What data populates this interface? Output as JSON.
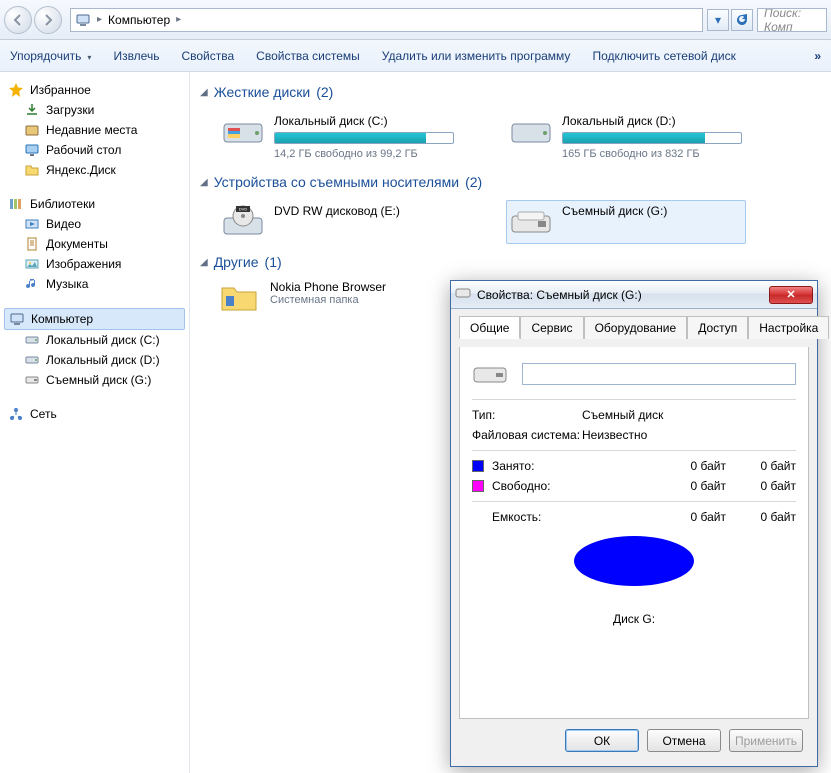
{
  "nav": {
    "breadcrumb": "Компьютер",
    "search_placeholder": "Поиск: Комп"
  },
  "toolbar": {
    "organize": "Упорядочить",
    "eject": "Извлечь",
    "properties": "Свойства",
    "system_properties": "Свойства системы",
    "add_remove_programs": "Удалить или изменить программу",
    "map_network_drive": "Подключить сетевой диск",
    "more": "»"
  },
  "sidebar": {
    "favorites": {
      "label": "Избранное",
      "items": [
        {
          "label": "Загрузки",
          "icon": "download-icon",
          "color": "#2e7d32"
        },
        {
          "label": "Недавние места",
          "icon": "recent-icon",
          "color": "#8d6e3c"
        },
        {
          "label": "Рабочий стол",
          "icon": "desktop-icon",
          "color": "#2a6fb8"
        },
        {
          "label": "Яндекс.Диск",
          "icon": "yandex-icon",
          "color": "#f0c000"
        }
      ]
    },
    "libraries": {
      "label": "Библиотеки",
      "items": [
        {
          "label": "Видео",
          "icon": "video-icon",
          "color": "#3f7fbf"
        },
        {
          "label": "Документы",
          "icon": "documents-icon",
          "color": "#d59b3b"
        },
        {
          "label": "Изображения",
          "icon": "images-icon",
          "color": "#5aa5b8"
        },
        {
          "label": "Музыка",
          "icon": "music-icon",
          "color": "#4a7fca"
        }
      ]
    },
    "computer": {
      "label": "Компьютер",
      "items": [
        {
          "label": "Локальный диск (C:)",
          "icon": "hdd-icon"
        },
        {
          "label": "Локальный диск (D:)",
          "icon": "hdd-icon"
        },
        {
          "label": "Съемный диск (G:)",
          "icon": "removable-icon"
        }
      ]
    },
    "network": {
      "label": "Сеть"
    }
  },
  "content": {
    "sections": [
      {
        "title": "Жесткие диски",
        "count": "(2)",
        "drives": [
          {
            "name": "Локальный диск (C:)",
            "sub": "14,2 ГБ свободно из 99,2 ГБ",
            "fill_pct": 85
          },
          {
            "name": "Локальный диск (D:)",
            "sub": "165 ГБ свободно из 832 ГБ",
            "fill_pct": 80
          }
        ]
      },
      {
        "title": "Устройства со съемными носителями",
        "count": "(2)",
        "drives": [
          {
            "name": "DVD RW дисковод (E:)",
            "icon": "dvd-icon"
          },
          {
            "name": "Съемный диск (G:)",
            "icon": "removable-icon",
            "selected": true
          }
        ]
      },
      {
        "title": "Другие",
        "count": "(1)",
        "folder": {
          "name": "Nokia Phone Browser",
          "sub": "Системная папка"
        }
      }
    ]
  },
  "dialog": {
    "title": "Свойства: Съемный диск (G:)",
    "tabs": [
      "Общие",
      "Сервис",
      "Оборудование",
      "Доступ",
      "Настройка"
    ],
    "active_tab": 0,
    "name_value": "",
    "type_label": "Тип:",
    "type_value": "Съемный диск",
    "fs_label": "Файловая система:",
    "fs_value": "Неизвестно",
    "used_label": "Занято:",
    "used_bytes": "0 байт",
    "used_human": "0 байт",
    "free_label": "Свободно:",
    "free_bytes": "0 байт",
    "free_human": "0 байт",
    "capacity_label": "Емкость:",
    "capacity_bytes": "0 байт",
    "capacity_human": "0 байт",
    "disk_label": "Диск G:",
    "buttons": {
      "ok": "ОК",
      "cancel": "Отмена",
      "apply": "Применить"
    }
  },
  "chart_data": {
    "type": "pie",
    "title": "Диск G:",
    "series": [
      {
        "name": "Занято",
        "value": 0,
        "color": "#0000ff"
      },
      {
        "name": "Свободно",
        "value": 0,
        "color": "#ff00ff"
      }
    ]
  }
}
